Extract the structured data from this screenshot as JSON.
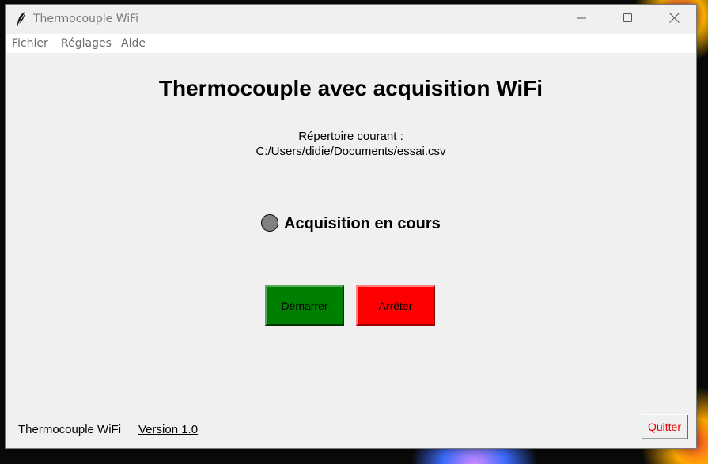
{
  "window": {
    "title": "Thermocouple WiFi"
  },
  "menu": {
    "items": [
      "Fichier",
      "Réglages",
      "Aide"
    ]
  },
  "main": {
    "title": "Thermocouple avec acquisition WiFi",
    "directory_label": "Répertoire courant :",
    "directory_path": "C:/Users/didie/Documents/essai.csv",
    "acquisition_label": "Acquisition en cours",
    "indicator_color": "#808080"
  },
  "buttons": {
    "start_label": "Démarrer",
    "start_color": "#008000",
    "stop_label": "Arrêter",
    "stop_color": "#ff0000",
    "quit_label": "Quitter",
    "quit_text_color": "#e60000"
  },
  "footer": {
    "app_name": "Thermocouple WiFi",
    "version": "Version 1.0"
  },
  "icons": {
    "app": "feather-icon",
    "minimize": "minimize-icon",
    "maximize": "maximize-icon",
    "close": "close-icon"
  }
}
